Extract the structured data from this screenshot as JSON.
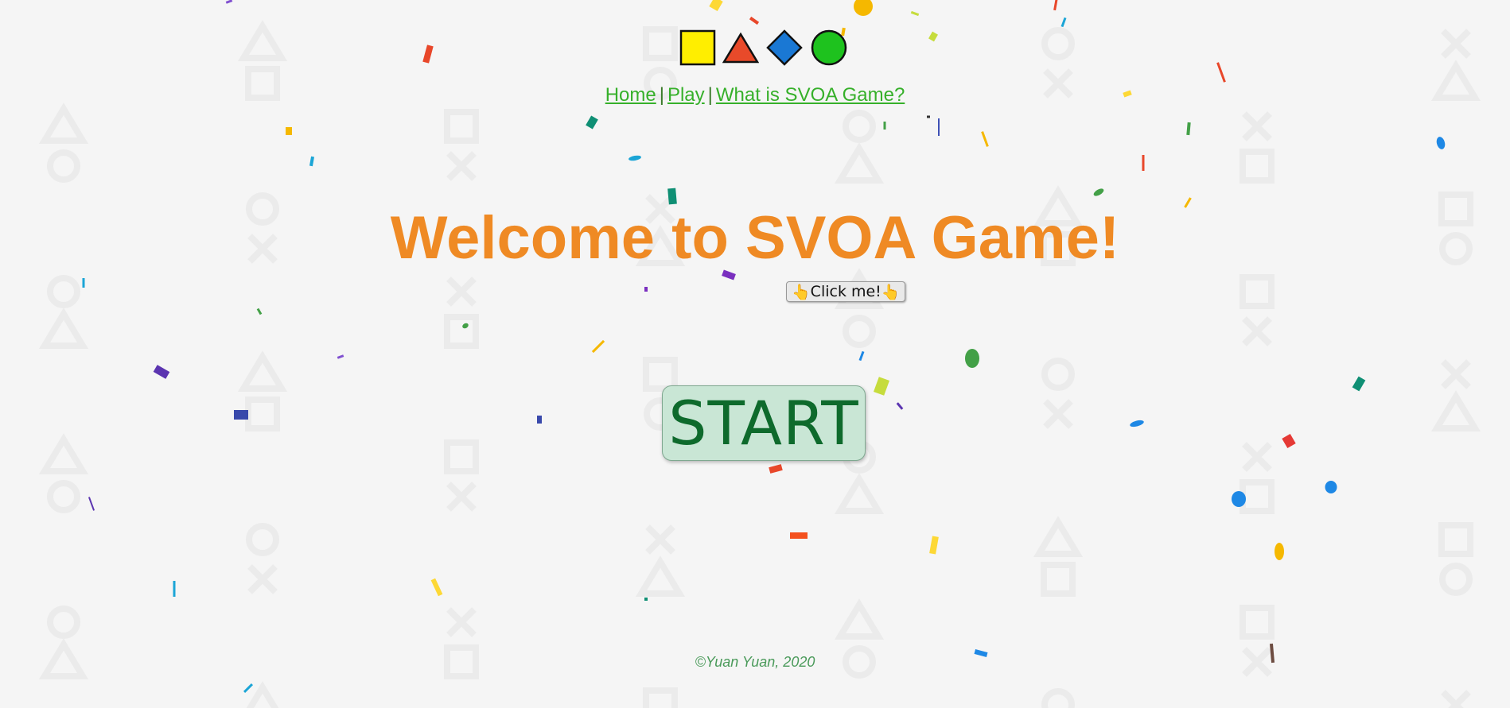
{
  "colors": {
    "background": "#f5f5f5",
    "pattern": "#ebebeb",
    "title": "#ef8a24",
    "nav_link": "#36b02a",
    "start_bg": "#c9e6d5",
    "start_text": "#0e6a2c",
    "footer": "#4a9a5a"
  },
  "logo": {
    "shapes": [
      "square-icon",
      "triangle-icon",
      "diamond-icon",
      "circle-icon"
    ],
    "colors": [
      "#ffee00",
      "#e84a2a",
      "#1a78d4",
      "#1ec21e"
    ]
  },
  "nav": {
    "items": [
      {
        "label": "Home"
      },
      {
        "label": "Play"
      },
      {
        "label": "What is SVOA Game?"
      }
    ],
    "separator": "|"
  },
  "title": "Welcome to SVOA Game!",
  "click_button": {
    "icon_left": "👆",
    "label": "Click me!",
    "icon_right": "👆"
  },
  "start_button": {
    "label": "START"
  },
  "footer": {
    "text": "©Yuan Yuan, 2020"
  }
}
